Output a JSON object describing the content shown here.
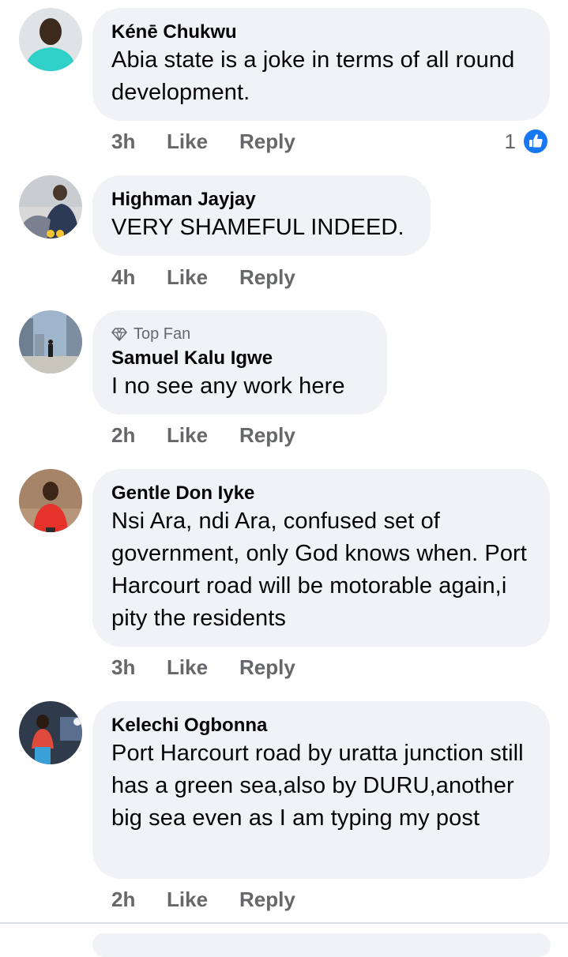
{
  "comments": [
    {
      "author": "Kénē Chukwu",
      "text": "Abia state is a joke in terms of all round development.",
      "time": "3h",
      "like_label": "Like",
      "reply_label": "Reply",
      "reaction_count": "1",
      "avatar_color": "#37d3cc"
    },
    {
      "author": "Highman Jayjay",
      "text": "VERY SHAMEFUL INDEED.",
      "time": "4h",
      "like_label": "Like",
      "reply_label": "Reply",
      "avatar_color": "#5b6370"
    },
    {
      "badge": "Top Fan",
      "author": "Samuel Kalu Igwe",
      "text": "I no see any work here",
      "time": "2h",
      "like_label": "Like",
      "reply_label": "Reply",
      "avatar_color": "#7a8fa8"
    },
    {
      "author": "Gentle Don Iyke",
      "text": "Nsi Ara, ndi Ara, confused set of government, only God knows when. Port Harcourt road will be motorable again,i pity the residents",
      "time": "3h",
      "like_label": "Like",
      "reply_label": "Reply",
      "avatar_color": "#b2876a"
    },
    {
      "author": "Kelechi Ogbonna",
      "text": "Port Harcourt road by uratta junction still has a green sea,also by DURU,another big sea even as I am typing my post",
      "time": "2h",
      "like_label": "Like",
      "reply_label": "Reply",
      "avatar_color": "#2c3e58"
    }
  ],
  "colors": {
    "bubble": "#f0f2f5",
    "meta_text": "#65676b",
    "like_blue": "#1877f2"
  }
}
